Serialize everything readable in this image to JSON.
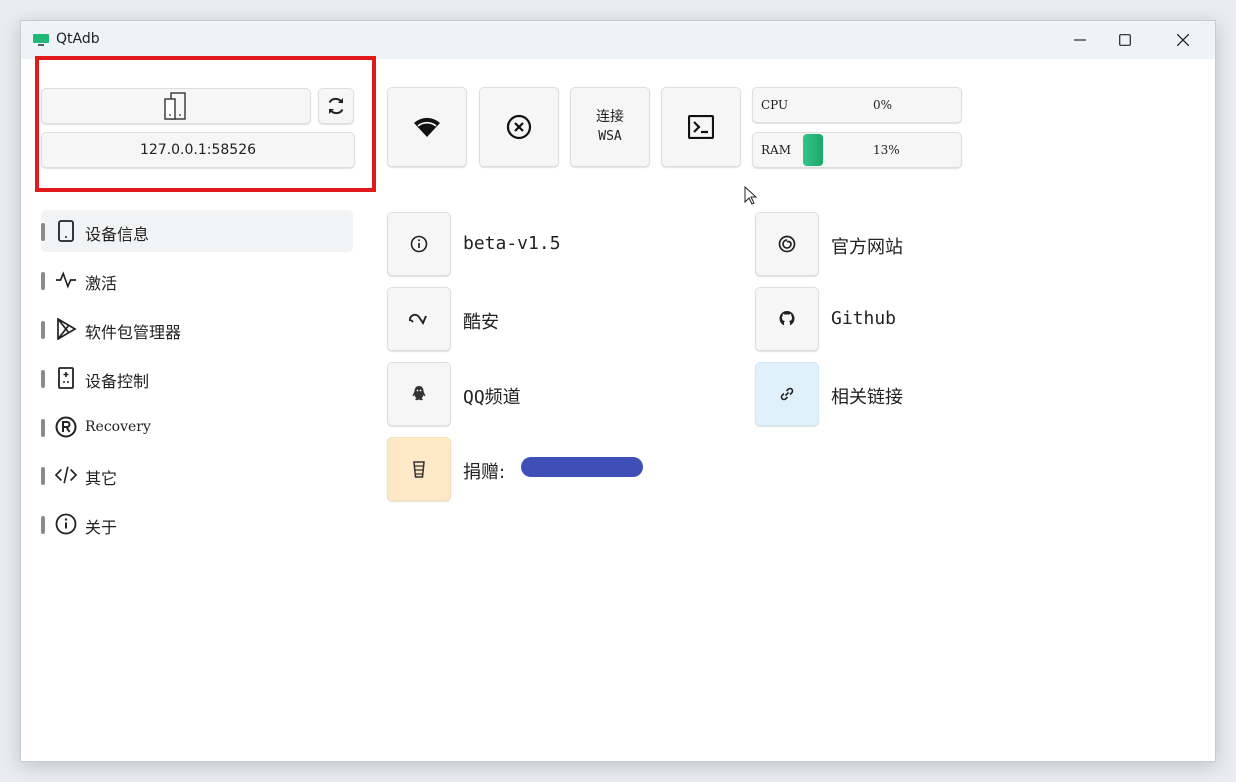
{
  "window": {
    "title": "QtAdb"
  },
  "device": {
    "address": "127.0.0.1:58526"
  },
  "sidebar": {
    "items": [
      {
        "label": "设备信息",
        "icon": "phone-icon",
        "active": true
      },
      {
        "label": "激活",
        "icon": "activity-icon",
        "active": false
      },
      {
        "label": "软件包管理器",
        "icon": "play-store-icon",
        "active": false
      },
      {
        "label": "设备控制",
        "icon": "remote-control-icon",
        "active": false
      },
      {
        "label": "Recovery",
        "icon": "recovery-icon",
        "active": false
      },
      {
        "label": "其它",
        "icon": "code-icon",
        "active": false
      },
      {
        "label": "关于",
        "icon": "info-circle-icon",
        "active": false
      }
    ]
  },
  "toolbar": {
    "wsa_label_line1": "连接",
    "wsa_label_line2": "WSA"
  },
  "meters": {
    "cpu": {
      "label": "CPU",
      "value": "0%",
      "fraction": 0.0
    },
    "ram": {
      "label": "RAM",
      "value": "13%",
      "fraction": 0.13
    }
  },
  "info": {
    "version": "beta-v1.5",
    "website": "官方网站",
    "coolapk": "酷安",
    "github": "Github",
    "qq": "QQ频道",
    "links": "相关链接",
    "donate": "捐赠:"
  },
  "colors": {
    "selection_box": "#e21a1a",
    "accent_green": "#19a866",
    "links_bg": "#e1f1fb",
    "donate_bg": "#fde9c6",
    "redaction": "#3f4fb8"
  }
}
